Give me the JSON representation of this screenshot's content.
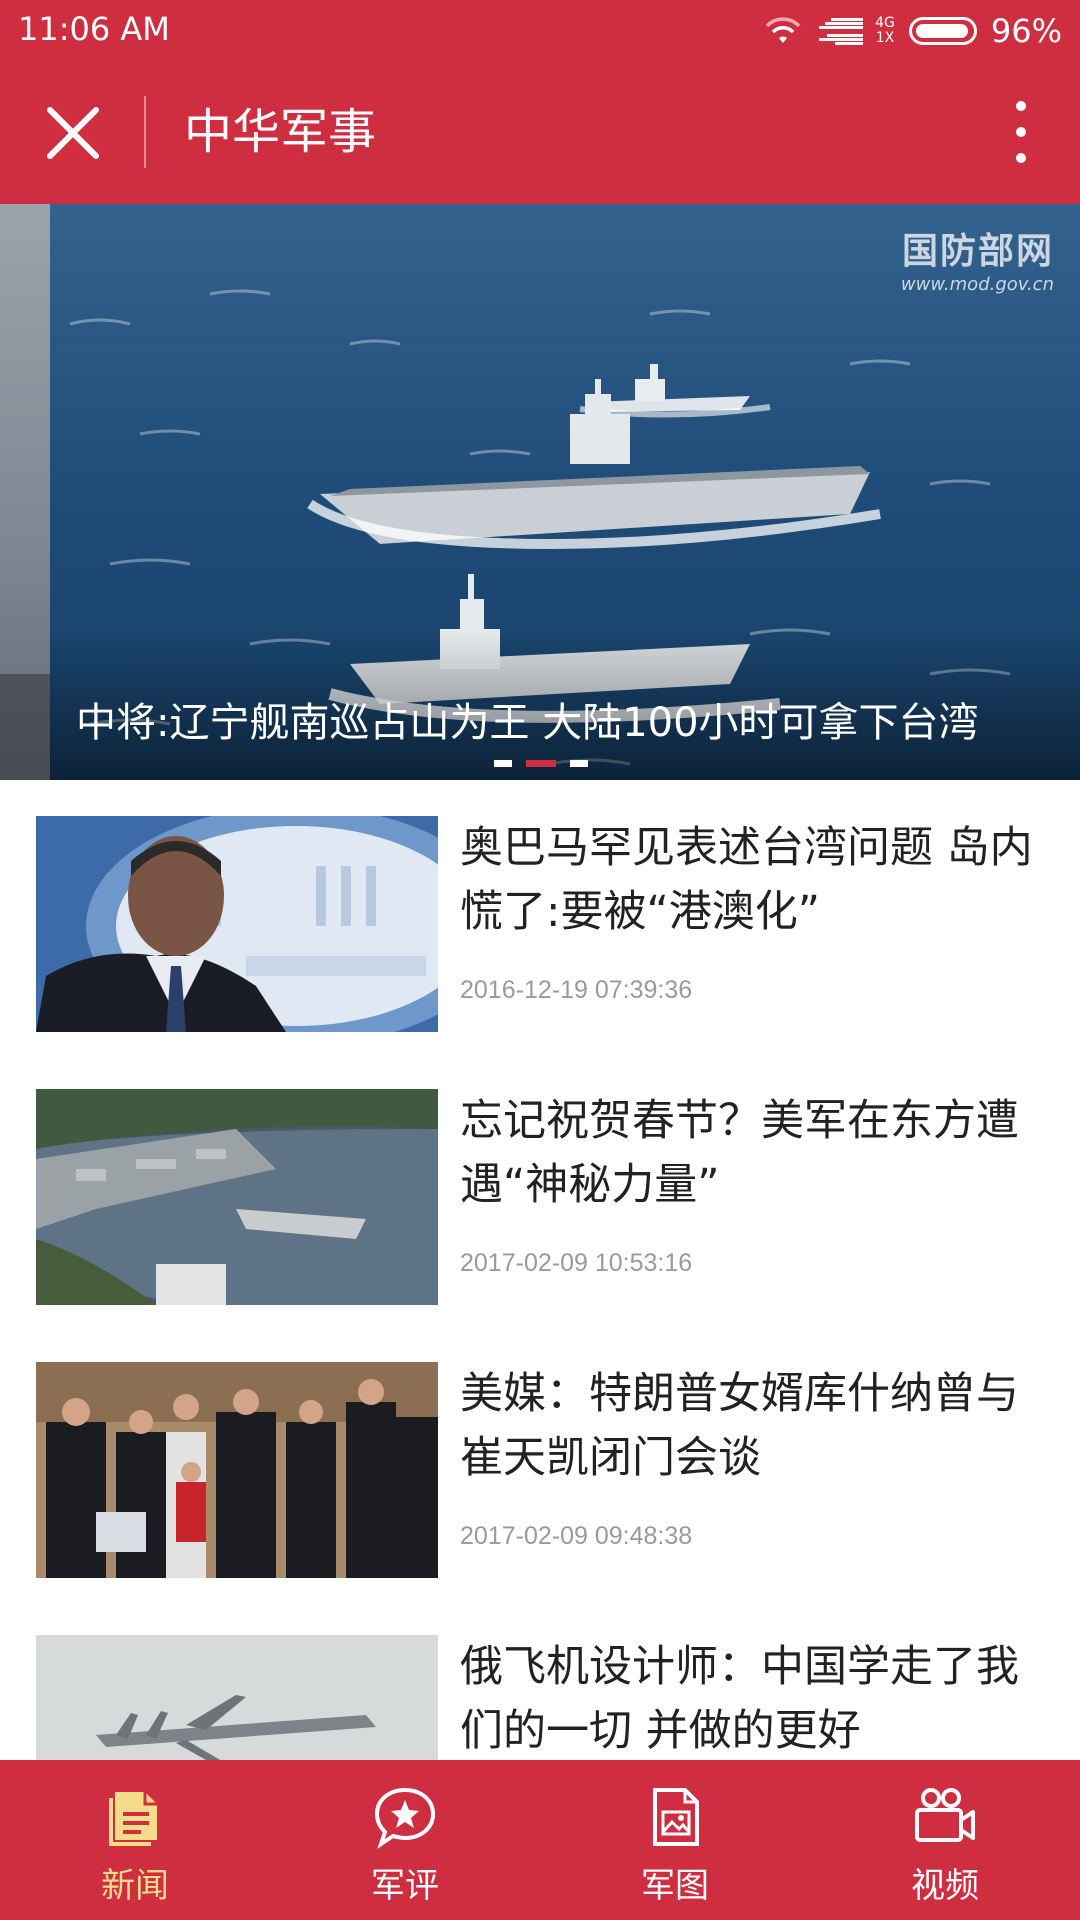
{
  "status_bar": {
    "time": "11:06  AM",
    "network_top": "4G",
    "network_bottom": "1X",
    "battery_level": 0.96,
    "battery_text": "96%"
  },
  "app_bar": {
    "title": "中华军事",
    "close_icon": "close-icon",
    "more_icon": "more-vertical-icon"
  },
  "banner": {
    "watermark_big": "国防部网",
    "watermark_small": "www.mod.gov.cn",
    "caption": "中将:辽宁舰南巡占山为王 大陆100小时可拿下台湾",
    "page_count": 3,
    "active_page": 2
  },
  "news": [
    {
      "title": "奥巴马罕见表述台湾问题 岛内慌了:要被“港澳化”",
      "time": "2016-12-19 07:39:36"
    },
    {
      "title": "忘记祝贺春节？美军在东方遭遇“神秘力量”",
      "time": "2017-02-09 10:53:16"
    },
    {
      "title": "美媒：特朗普女婿库什纳曾与崔天凯闭门会谈",
      "time": "2017-02-09 09:48:38"
    },
    {
      "title": "俄飞机设计师：中国学走了我们的一切 并做的更好",
      "time": ""
    }
  ],
  "nav": [
    {
      "label": "新闻",
      "icon": "news-icon",
      "active": true
    },
    {
      "label": "军评",
      "icon": "comment-star-icon",
      "active": false
    },
    {
      "label": "军图",
      "icon": "gallery-icon",
      "active": false
    },
    {
      "label": "视频",
      "icon": "video-camera-icon",
      "active": false
    }
  ],
  "colors": {
    "brand_red": "#cf2e40",
    "nav_active": "#f4dc8a",
    "time_gray": "#9a9a9a"
  }
}
